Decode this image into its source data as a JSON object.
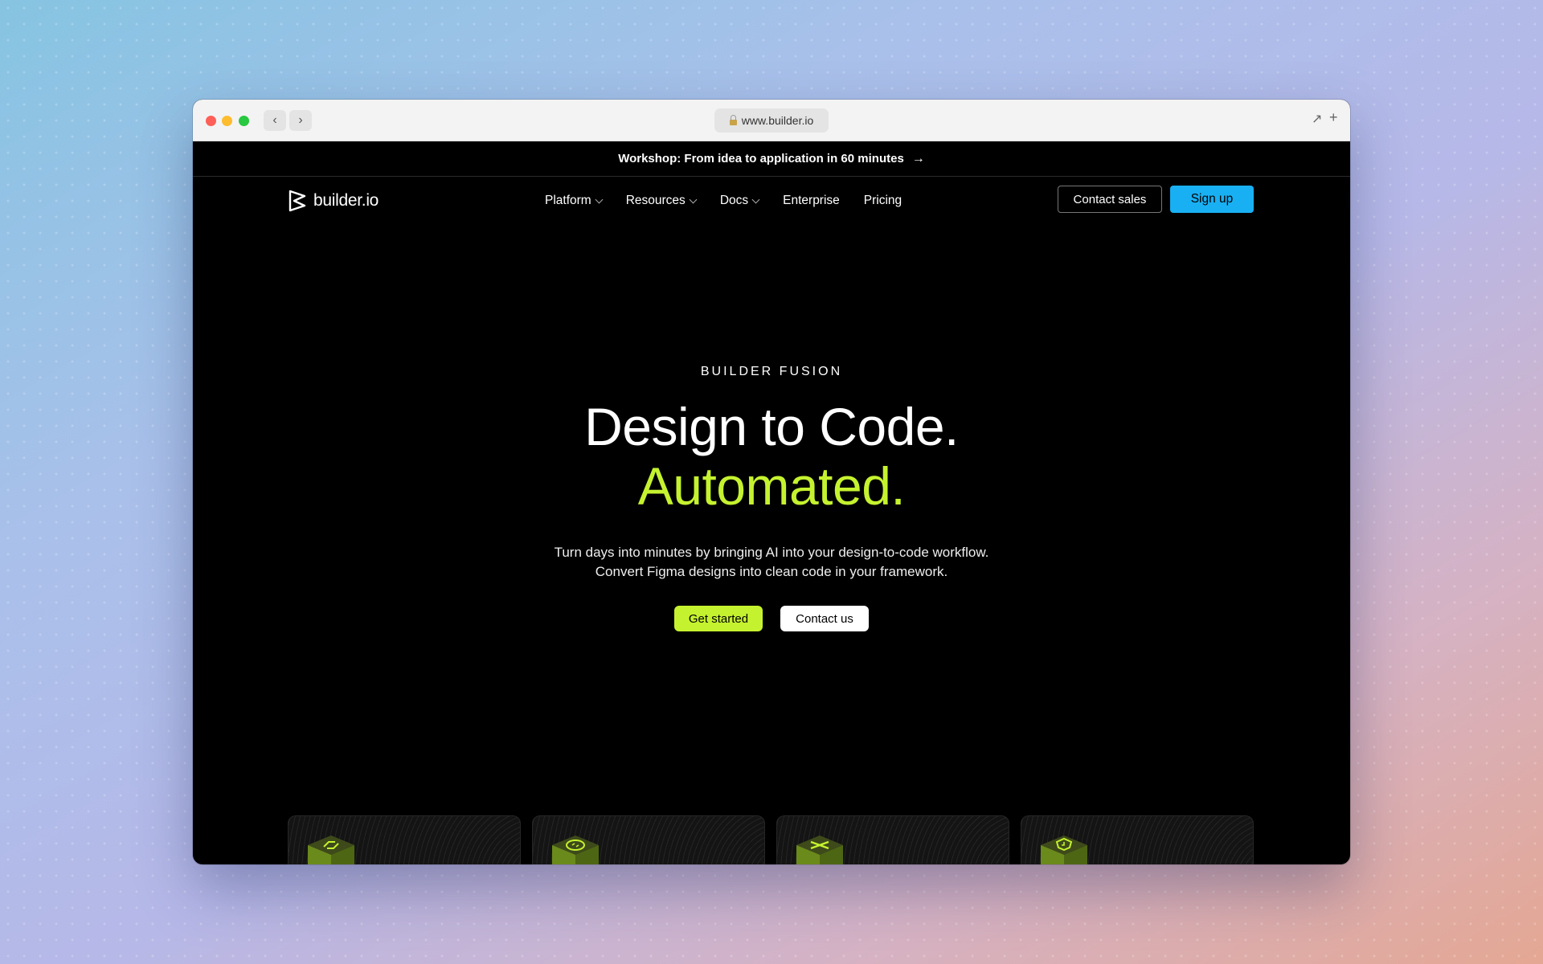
{
  "browser": {
    "url": "www.builder.io",
    "back_icon": "chevron-left-icon",
    "forward_icon": "chevron-right-icon"
  },
  "announcement": {
    "text": "Workshop: From idea to application in 60 minutes",
    "arrow": "→"
  },
  "nav": {
    "logo_text": "builder.io",
    "menu": [
      {
        "label": "Platform",
        "dropdown": true
      },
      {
        "label": "Resources",
        "dropdown": true
      },
      {
        "label": "Docs",
        "dropdown": true
      },
      {
        "label": "Enterprise",
        "dropdown": false
      },
      {
        "label": "Pricing",
        "dropdown": false
      }
    ],
    "contact_sales": "Contact sales",
    "sign_up": "Sign up"
  },
  "hero": {
    "eyebrow": "BUILDER FUSION",
    "headline_line1": "Design to Code.",
    "headline_line2": "Automated.",
    "subheadline": "Turn days into minutes by bringing AI into your design-to-code workflow. Convert Figma designs into clean code in your framework.",
    "primary_cta": "Get started",
    "secondary_cta": "Contact us"
  },
  "colors": {
    "accent_green": "#c5f22f",
    "signup_blue": "#19b0f3",
    "page_background": "#000000"
  },
  "feature_cards": [
    {
      "icon": "arrows-swap-icon"
    },
    {
      "icon": "code-brackets-icon"
    },
    {
      "icon": "link-icon"
    },
    {
      "icon": "shield-lock-icon"
    }
  ]
}
